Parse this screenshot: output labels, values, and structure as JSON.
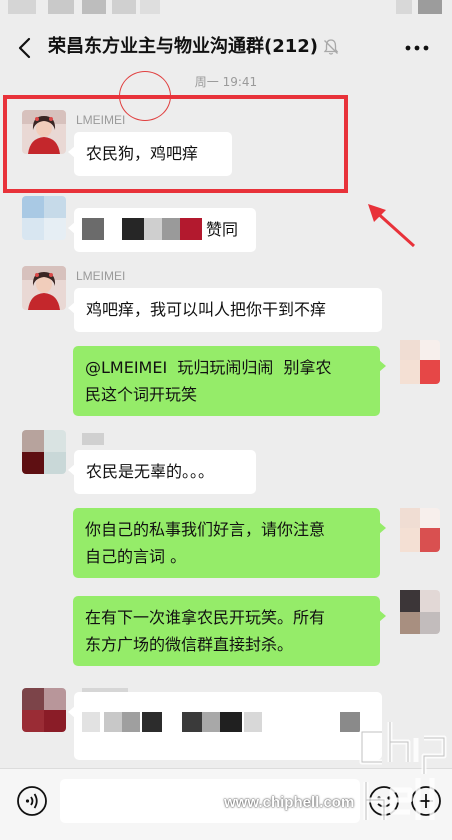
{
  "header": {
    "title": "荣昌东方业主与物业沟通群(212)",
    "back_icon": "chevron-left-icon",
    "mute_icon": "bell-muted-icon",
    "more_icon": "more-dots-icon"
  },
  "timestamp": "周一 19:41",
  "messages": [
    {
      "side": "left",
      "sender": "LMEIMEI",
      "text": "农民狗，鸡吧痒"
    },
    {
      "side": "left",
      "sender": "",
      "text": "赞同"
    },
    {
      "side": "left",
      "sender": "LMEIMEI",
      "text": "鸡吧痒，我可以叫人把你干到不痒"
    },
    {
      "side": "right",
      "lines": [
        "@LMEIMEI  玩归玩闹归闹  别拿农",
        "民这个词开玩笑"
      ]
    },
    {
      "side": "left",
      "sender": "",
      "text": "农民是无辜的。。。"
    },
    {
      "side": "right",
      "lines": [
        "你自己的私事我们好言，请你注意",
        "自己的言词 。"
      ]
    },
    {
      "side": "right",
      "lines": [
        "在有下一次谁拿农民开玩笑。所有",
        "东方广场的微信群直接封杀。"
      ]
    }
  ],
  "input_bar": {
    "voice_icon": "voice-icon",
    "emoji_icon": "emoji-icon",
    "plus_icon": "plus-icon",
    "placeholder": ""
  },
  "watermark": {
    "url": "www.chiphell.com",
    "logo_text": "chip hell"
  },
  "colors": {
    "background": "#ededed",
    "sent_bubble": "#95ec69",
    "received_bubble": "#ffffff",
    "highlight": "#e8323a"
  }
}
